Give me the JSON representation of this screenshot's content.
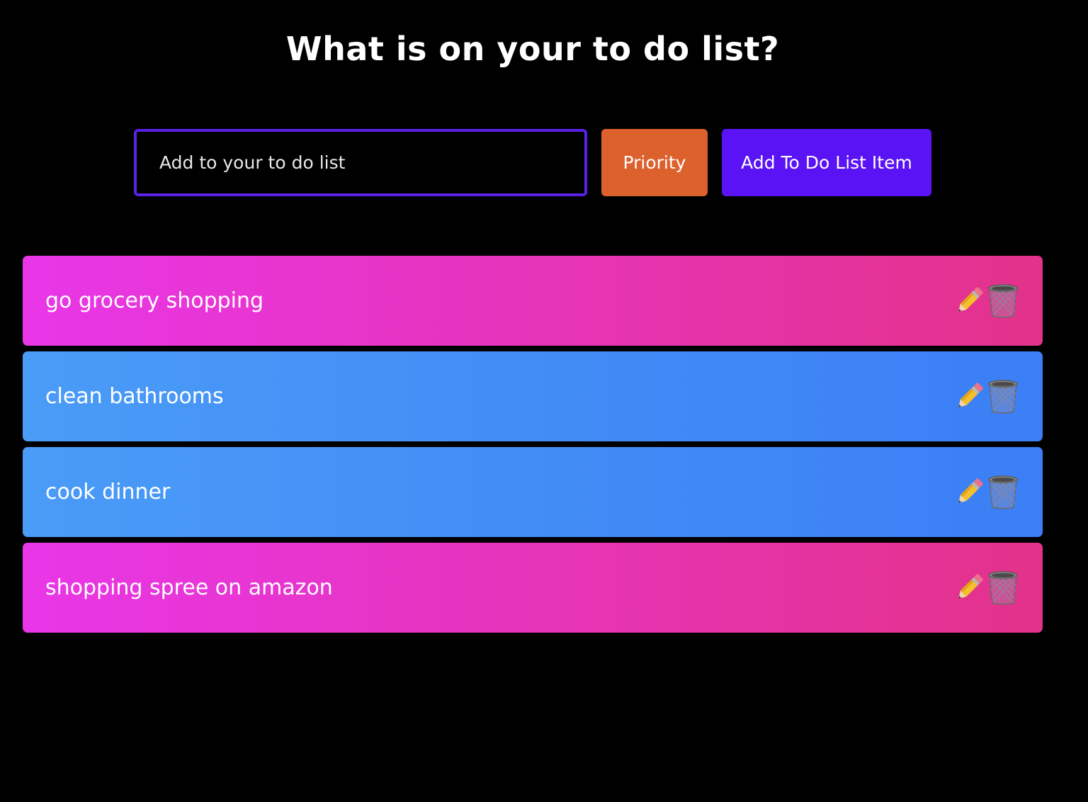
{
  "header": {
    "title": "What is on your to do list?"
  },
  "form": {
    "input_placeholder": "Add to your to do list",
    "input_value": "",
    "priority_label": "Priority",
    "add_label": "Add To Do List Item"
  },
  "todos": [
    {
      "text": "go grocery shopping",
      "priority": "high",
      "color": "pink"
    },
    {
      "text": "clean bathrooms",
      "priority": "normal",
      "color": "blue"
    },
    {
      "text": "cook dinner",
      "priority": "normal",
      "color": "blue"
    },
    {
      "text": "shopping spree on amazon",
      "priority": "high",
      "color": "pink"
    }
  ],
  "icons": {
    "edit": "pencil-icon",
    "delete": "trash-icon"
  },
  "colors": {
    "background": "#000000",
    "input_border": "#5a22e6",
    "priority_button": "#dc612c",
    "add_button": "#5a13f5",
    "high_priority_gradient": [
      "#e936e8",
      "#e3328a"
    ],
    "normal_priority_gradient": [
      "#4a9cf7",
      "#3b7ef6"
    ]
  }
}
